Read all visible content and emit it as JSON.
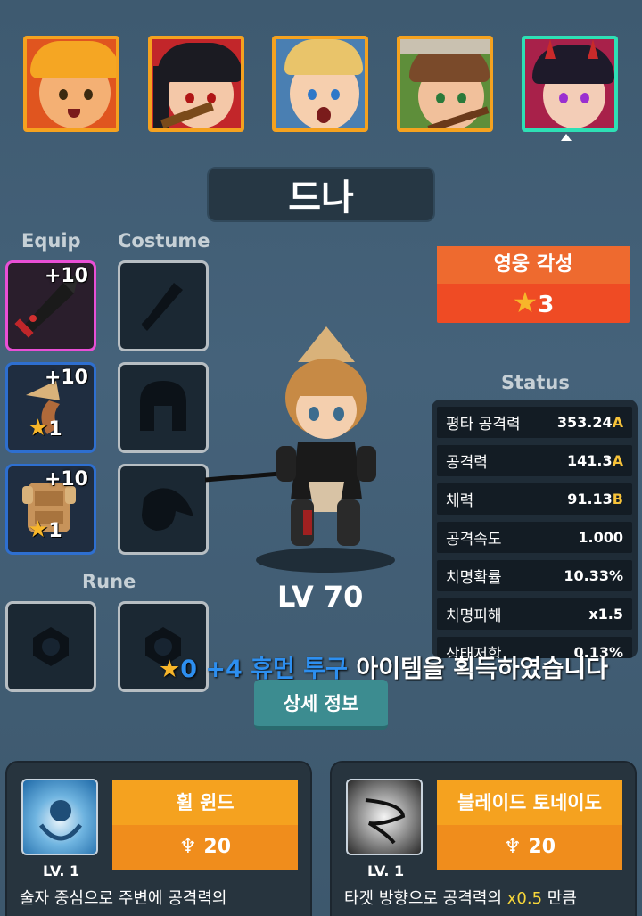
{
  "heroes": [
    {
      "name": "hero-1",
      "skin": "#f4b074",
      "hair": "#f5a623",
      "bg": "#e0551f"
    },
    {
      "name": "hero-2",
      "skin": "#f4c8a8",
      "hair": "#1b1b22",
      "bg": "#c2262a"
    },
    {
      "name": "hero-3",
      "skin": "#f6cfae",
      "hair": "#e9c46a",
      "bg": "#4a7fb2"
    },
    {
      "name": "hero-4",
      "skin": "#f1c09b",
      "hair": "#7a4a2a",
      "bg": "#5e8e3a"
    },
    {
      "name": "hero-5",
      "skin": "#f3cdb7",
      "hair": "#1e1a2a",
      "bg": "#a8214a"
    }
  ],
  "hero_name": "드나",
  "labels": {
    "equip": "Equip",
    "costume": "Costume",
    "rune": "Rune",
    "status": "Status"
  },
  "equip": [
    {
      "plus": "+10",
      "stars": ""
    },
    {
      "plus": "+10",
      "stars": "1"
    },
    {
      "plus": "+10",
      "stars": "1"
    }
  ],
  "awaken": {
    "title": "영웅 각성",
    "count": "3",
    "star": "★"
  },
  "status": [
    {
      "label": "평타 공격력",
      "value": "353.24",
      "grade": "A"
    },
    {
      "label": "공격력",
      "value": "141.3",
      "grade": "A"
    },
    {
      "label": "체력",
      "value": "91.13",
      "grade": "B"
    },
    {
      "label": "공격속도",
      "value": "1.000",
      "grade": ""
    },
    {
      "label": "치명확률",
      "value": "10.33%",
      "grade": ""
    },
    {
      "label": "치명피해",
      "value": "x1.5",
      "grade": ""
    },
    {
      "label": "상태저항",
      "value": "0.13%",
      "grade": ""
    }
  ],
  "level": "LV 70",
  "notice": {
    "star": "★",
    "item": "0 +4 휴먼 투구",
    "text": " 아이템을 획득하였습니다"
  },
  "detail_button": "상세 정보",
  "skills": [
    {
      "name": "휠 윈드",
      "cost": "20",
      "lv": "LV. 1",
      "desc_a": "술자 중심으로 주변에 공격력의",
      "desc_hl": "",
      "desc_b": ""
    },
    {
      "name": "블레이드 토네이도",
      "cost": "20",
      "lv": "LV. 1",
      "desc_a": "타겟 방향으로 공격력의 ",
      "desc_hl": "x0.5",
      "desc_b": " 만큼"
    }
  ],
  "colors": {
    "accent": "#f5a21f",
    "selected": "#2ee0b5",
    "awaken": "#ef4b24",
    "grade": "#f7c33a"
  }
}
